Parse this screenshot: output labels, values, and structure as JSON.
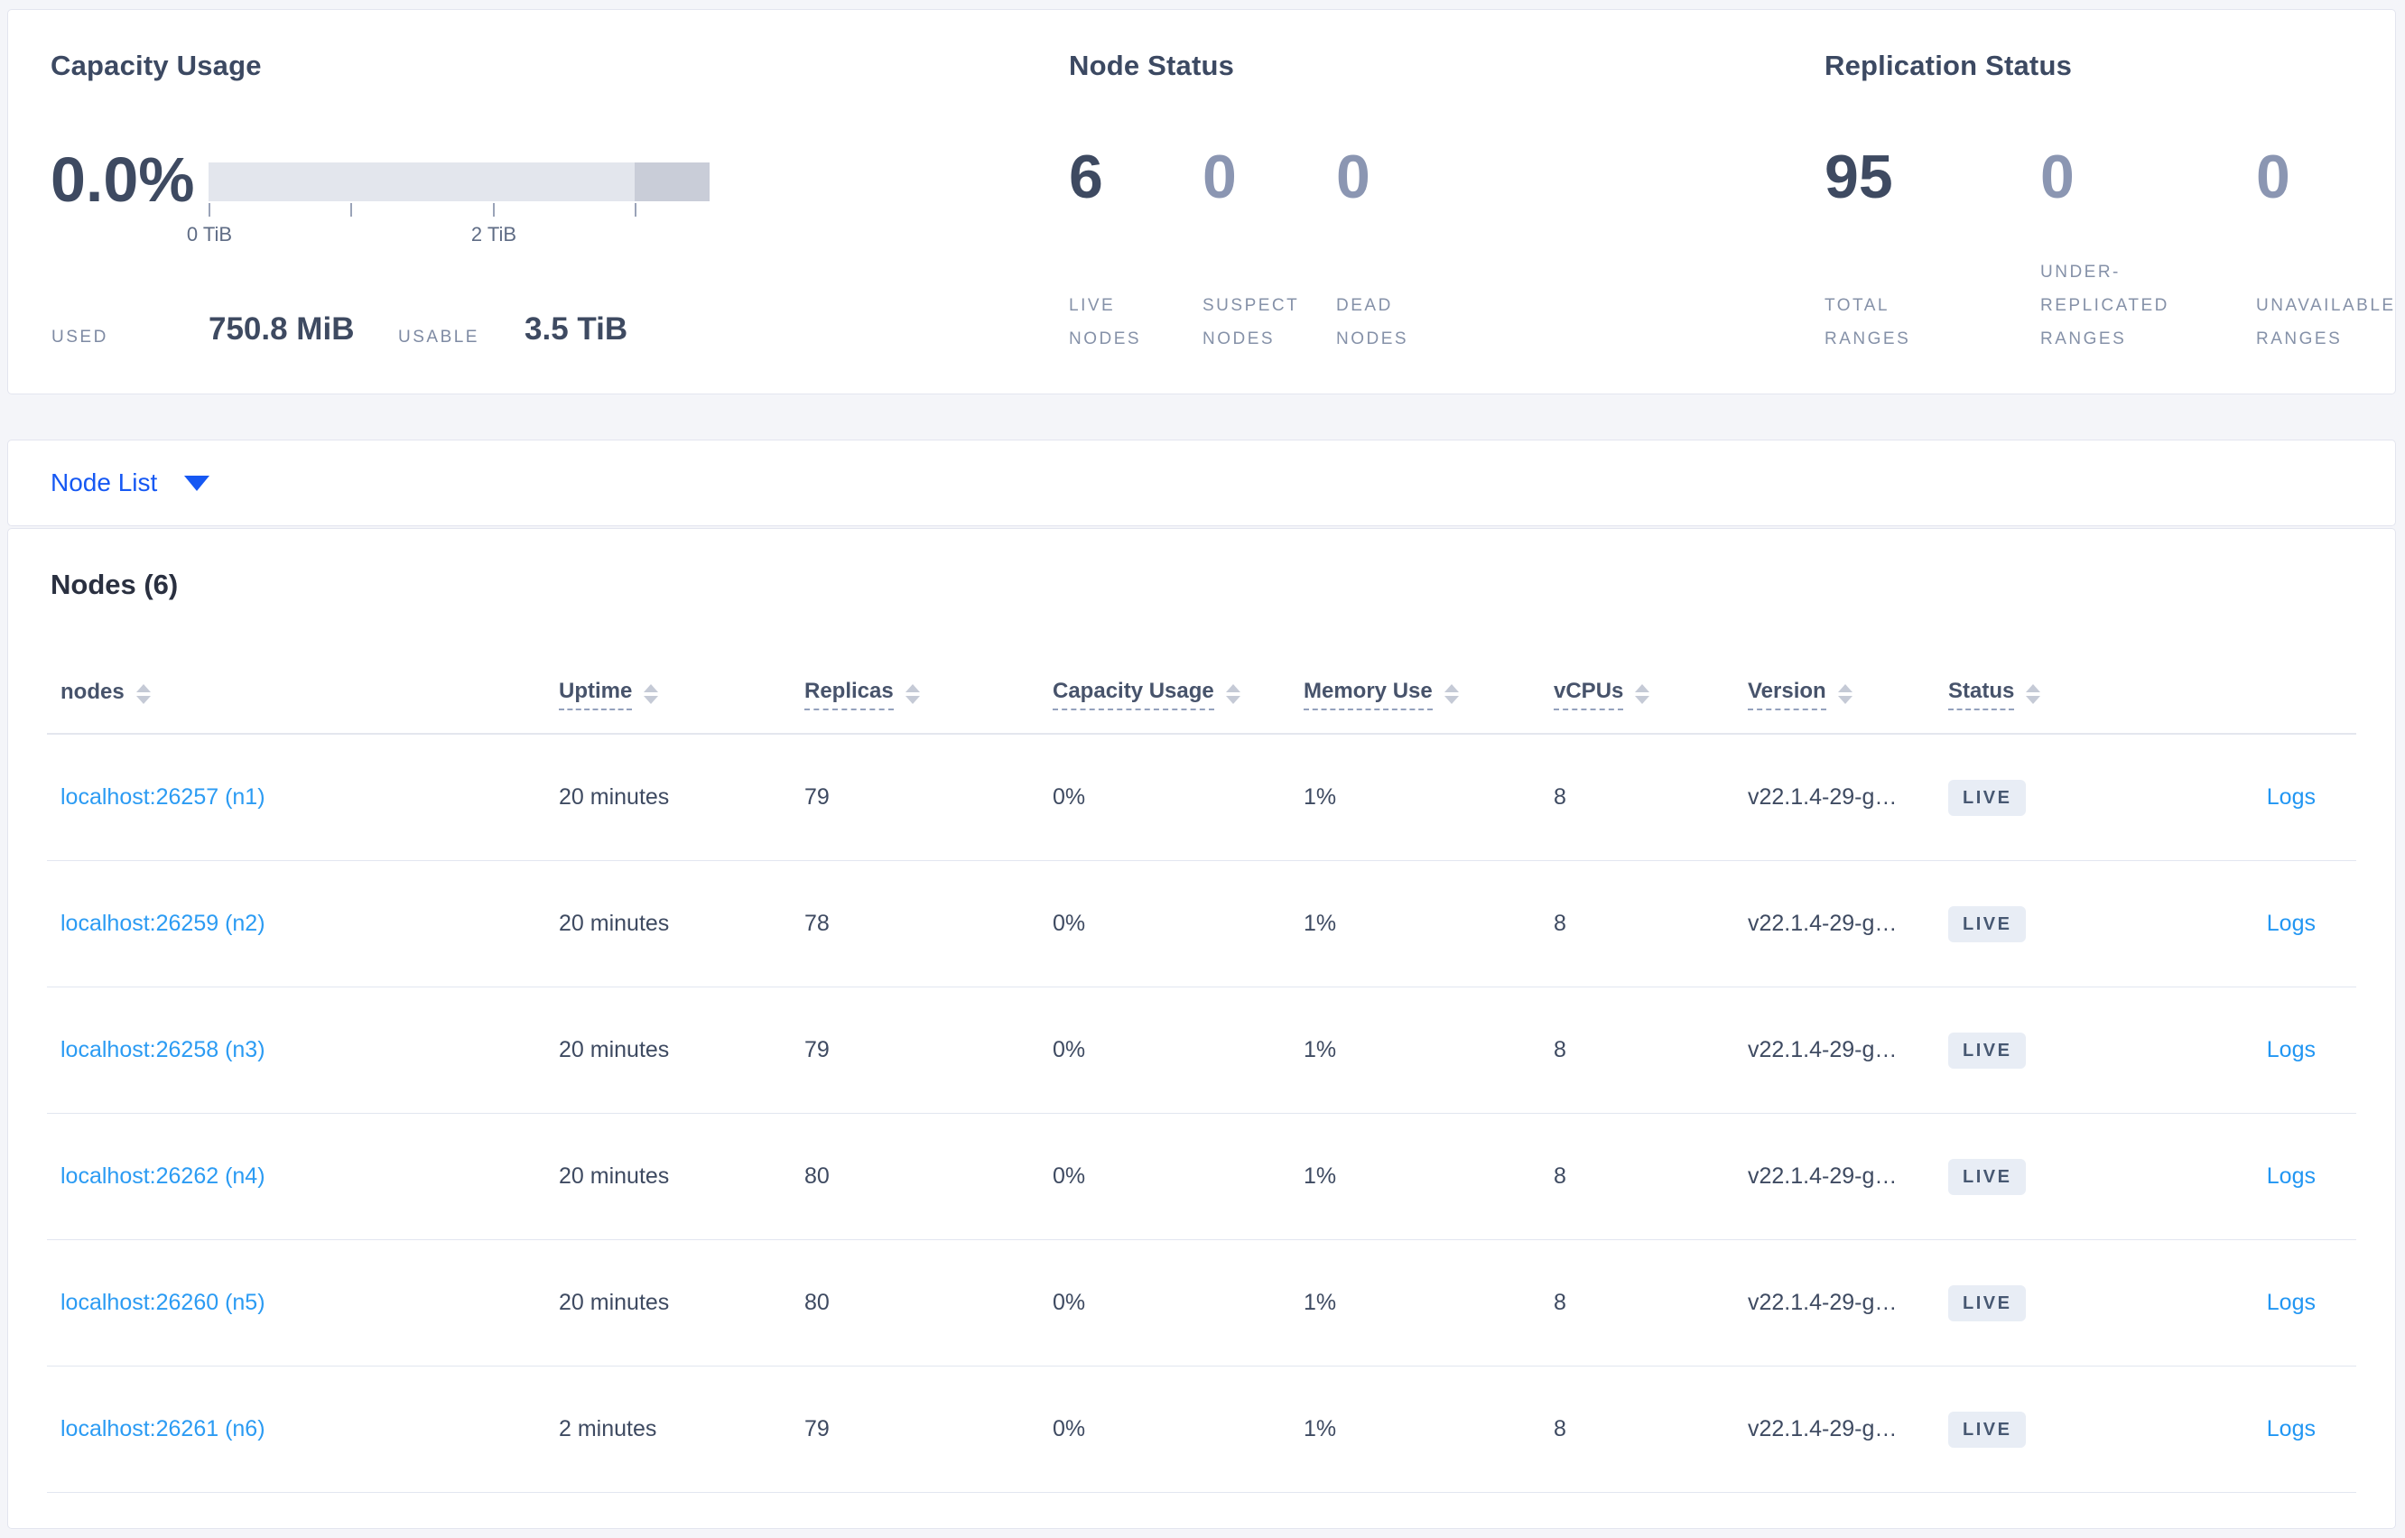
{
  "overview": {
    "capacity": {
      "title": "Capacity Usage",
      "percent": "0.0%",
      "used_label": "USED",
      "used_value": "750.8 MiB",
      "usable_label": "USABLE",
      "usable_value": "3.5 TiB",
      "axis_tick_labels": [
        "0 TiB",
        "2 TiB"
      ],
      "bar": {
        "usable_tib": 3.5,
        "used_fraction": 0.0,
        "light_segment_fraction": 0.851
      }
    },
    "node_status": {
      "title": "Node Status",
      "stats": [
        {
          "value": "6",
          "label_lines": [
            "LIVE",
            "NODES"
          ],
          "primary": true
        },
        {
          "value": "0",
          "label_lines": [
            "SUSPECT",
            "NODES"
          ],
          "primary": false
        },
        {
          "value": "0",
          "label_lines": [
            "DEAD",
            "NODES"
          ],
          "primary": false
        }
      ]
    },
    "replication": {
      "title": "Replication Status",
      "stats": [
        {
          "value": "95",
          "label_lines": [
            "TOTAL",
            "RANGES"
          ],
          "primary": true
        },
        {
          "value": "0",
          "label_lines": [
            "UNDER-",
            "REPLICATED",
            "RANGES"
          ],
          "primary": false
        },
        {
          "value": "0",
          "label_lines": [
            "UNAVAILABLE",
            "RANGES"
          ],
          "primary": false
        }
      ]
    }
  },
  "node_list": {
    "dropdown_label": "Node List"
  },
  "table": {
    "title": "Nodes (6)",
    "columns": [
      {
        "label": "nodes",
        "underline": false
      },
      {
        "label": "Uptime",
        "underline": true
      },
      {
        "label": "Replicas",
        "underline": true
      },
      {
        "label": "Capacity Usage",
        "underline": true
      },
      {
        "label": "Memory Use",
        "underline": true
      },
      {
        "label": "vCPUs",
        "underline": true
      },
      {
        "label": "Version",
        "underline": true
      },
      {
        "label": "Status",
        "underline": true
      }
    ],
    "rows": [
      {
        "node": "localhost:26257 (n1)",
        "uptime": "20 minutes",
        "replicas": "79",
        "capacity_usage": "0%",
        "memory_use": "1%",
        "vcpus": "8",
        "version": "v22.1.4-29-g…",
        "status": "LIVE",
        "logs": "Logs"
      },
      {
        "node": "localhost:26259 (n2)",
        "uptime": "20 minutes",
        "replicas": "78",
        "capacity_usage": "0%",
        "memory_use": "1%",
        "vcpus": "8",
        "version": "v22.1.4-29-g…",
        "status": "LIVE",
        "logs": "Logs"
      },
      {
        "node": "localhost:26258 (n3)",
        "uptime": "20 minutes",
        "replicas": "79",
        "capacity_usage": "0%",
        "memory_use": "1%",
        "vcpus": "8",
        "version": "v22.1.4-29-g…",
        "status": "LIVE",
        "logs": "Logs"
      },
      {
        "node": "localhost:26262 (n4)",
        "uptime": "20 minutes",
        "replicas": "80",
        "capacity_usage": "0%",
        "memory_use": "1%",
        "vcpus": "8",
        "version": "v22.1.4-29-g…",
        "status": "LIVE",
        "logs": "Logs"
      },
      {
        "node": "localhost:26260 (n5)",
        "uptime": "20 minutes",
        "replicas": "80",
        "capacity_usage": "0%",
        "memory_use": "1%",
        "vcpus": "8",
        "version": "v22.1.4-29-g…",
        "status": "LIVE",
        "logs": "Logs"
      },
      {
        "node": "localhost:26261 (n6)",
        "uptime": "2 minutes",
        "replicas": "79",
        "capacity_usage": "0%",
        "memory_use": "1%",
        "vcpus": "8",
        "version": "v22.1.4-29-g…",
        "status": "LIVE",
        "logs": "Logs"
      }
    ]
  },
  "colors": {
    "page_background": "#f4f5f9",
    "primary_number": "#3e4a61",
    "dim_number": "#8b96b2",
    "dropdown_blue": "#1658f3",
    "node_link_blue": "#2b9bf3",
    "logs_link_blue": "#2196f3",
    "badge_background": "#e8edf5",
    "badge_text": "#475872",
    "bar_light": "#e3e6ed",
    "bar_dark": "#c9cdd8"
  }
}
